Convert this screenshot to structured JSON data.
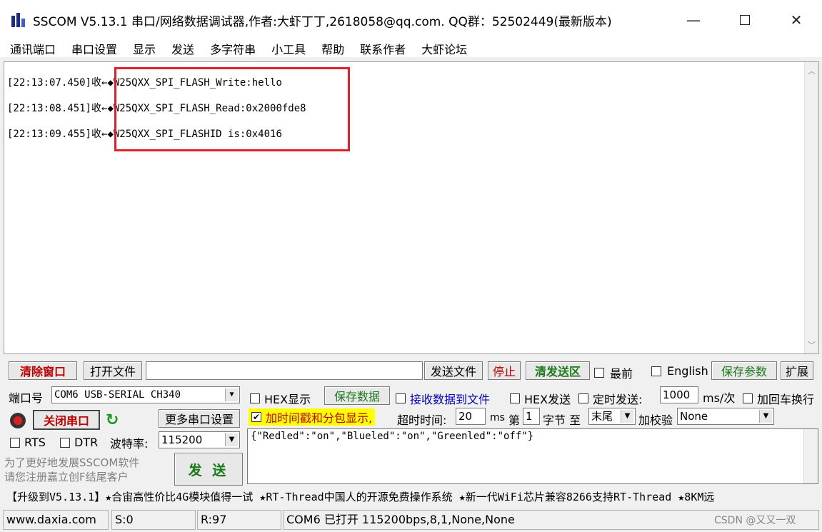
{
  "window": {
    "title": "SSCOM V5.13.1 串口/网络数据调试器,作者:大虾丁丁,2618058@qq.com. QQ群：52502449(最新版本)"
  },
  "menu": [
    "通讯端口",
    "串口设置",
    "显示",
    "发送",
    "多字符串",
    "小工具",
    "帮助",
    "联系作者",
    "大虾论坛"
  ],
  "receive": {
    "lines": [
      {
        "time": "[22:13:07.450]收←",
        "text": "◆W25QXX_SPI_FLASH_Write:hello"
      },
      {
        "time": "[22:13:08.451]收←",
        "text": "◆W25QXX_SPI_FLASH_Read:0x2000fde8"
      },
      {
        "time": "[22:13:09.455]收←",
        "text": "◆W25QXX_SPI_FLASHID is:0x4016"
      }
    ],
    "highlight_color": "#e3202a"
  },
  "toolbar": {
    "clear_window": "清除窗口",
    "open_file": "打开文件",
    "send_file": "发送文件",
    "stop": "停止",
    "clear_send": "清发送区",
    "topmost": "最前",
    "english": "English",
    "save_params": "保存参数",
    "expand": "扩展"
  },
  "port": {
    "port_label": "端口号",
    "port_value": "COM6 USB-SERIAL CH340",
    "close_port": "关闭串口",
    "more_settings": "更多串口设置",
    "rts": "RTS",
    "dtr": "DTR",
    "baud_label": "波特率:",
    "baud_value": "115200",
    "promo_line1": "为了更好地发展SSCOM软件",
    "promo_line2": "请您注册嘉立创F结尾客户"
  },
  "options": {
    "hex_display": "HEX显示",
    "save_data": "保存数据",
    "recv_to_file": "接收数据到文件",
    "hex_send": "HEX发送",
    "timed_send": "定时发送:",
    "interval_value": "1000",
    "interval_unit": "ms/次",
    "add_crlf": "加回车换行",
    "timestamp": "加时间戳和分包显示,",
    "timeout_label": "超时时间:",
    "timeout_value": "20",
    "timeout_unit": "ms",
    "nth_label": "第",
    "nth_value": "1",
    "byte_label": "字节 至",
    "end_value": "末尾",
    "checksum_label": "加校验",
    "checksum_value": "None"
  },
  "send": {
    "text": "{\"Redled\":\"on\",\"Blueled\":\"on\",\"Greenled\":\"off\"}",
    "send_button": "发 送"
  },
  "marquee": "【升级到V5.13.1】★合宙高性价比4G模块值得一试 ★RT-Thread中国人的开源免费操作系统 ★新一代WiFi芯片兼容8266支持RT-Thread ★8KM远",
  "status": {
    "website": "www.daxia.com",
    "sent": "S:0",
    "received": "R:97",
    "port_state": "COM6 已打开  115200bps,8,1,None,None",
    "watermark": "CSDN @又又一双"
  }
}
